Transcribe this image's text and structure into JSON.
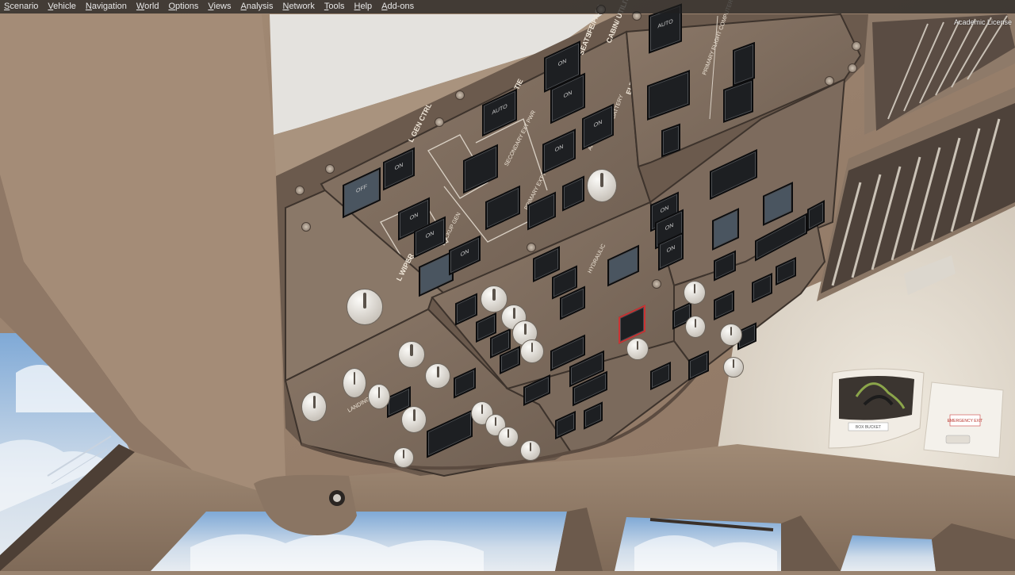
{
  "menu": {
    "items": [
      {
        "label": "Scenario",
        "mnemonic": "S",
        "rest": "cenario"
      },
      {
        "label": "Vehicle",
        "mnemonic": "V",
        "rest": "ehicle"
      },
      {
        "label": "Navigation",
        "mnemonic": "N",
        "rest": "avigation"
      },
      {
        "label": "World",
        "mnemonic": "W",
        "rest": "orld"
      },
      {
        "label": "Options",
        "mnemonic": "O",
        "rest": "ptions"
      },
      {
        "label": "Views",
        "mnemonic": "V",
        "rest": "iews"
      },
      {
        "label": "Analysis",
        "mnemonic": "A",
        "rest": "nalysis"
      },
      {
        "label": "Network",
        "mnemonic": "N",
        "rest": "etwork"
      },
      {
        "label": "Tools",
        "mnemonic": "T",
        "rest": "ools"
      },
      {
        "label": "Help",
        "mnemonic": "H",
        "rest": "elp"
      },
      {
        "label": "Add-ons",
        "mnemonic": "A",
        "rest": "dd-ons"
      }
    ]
  },
  "license": "Academic License",
  "panel": {
    "electrical_label": "ELECTRICAL",
    "battery_label": "BATTERY",
    "ife_label": "IFE/PASS",
    "seats_label": "SEATS",
    "cabin_utility_label": "CABIN/ UTILITY",
    "l_bus_tie": "L BUS TIE",
    "l_gen_ctrl": "L GEN CTRL",
    "secondary_ext_pwr": "SECONDARY EXT PWR",
    "primary_ext_pwr": "PRIMARY EXT PWR",
    "apu_gen": "APU GEN",
    "backup_gen": "BACKUP GEN",
    "l_wiper": "L WIPER",
    "primary_flight_computers": "PRIMARY FLIGHT COMPUTERS",
    "hydraulic": "HYDRAULIC",
    "landing": "LANDING",
    "auto": "AUTO",
    "on": "ON",
    "off": "OFF",
    "placard_white": "BOX BUCKET",
    "placard_red": "EMERGENCY EXIT"
  }
}
